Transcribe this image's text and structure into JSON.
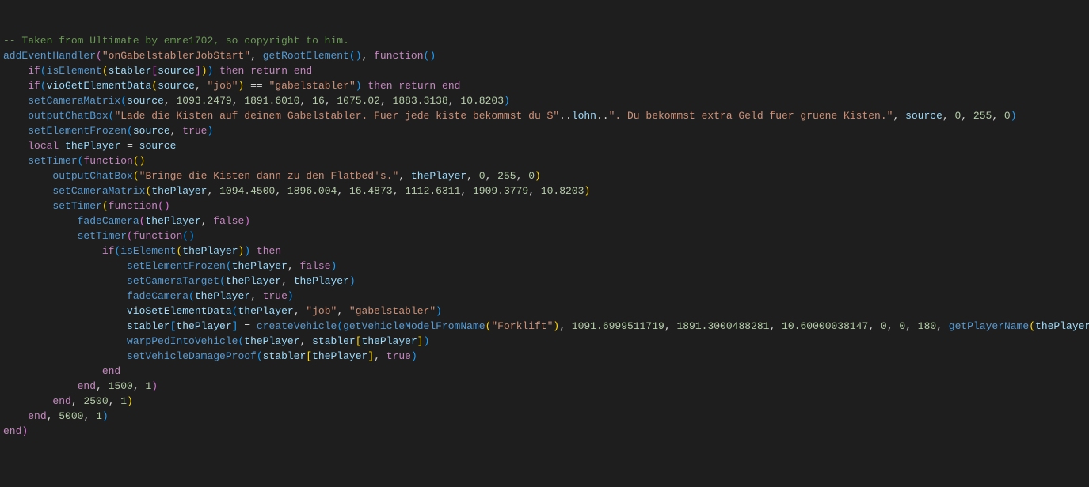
{
  "comment": "-- Taken from Ultimate by emre1702, so copyright to him.",
  "fn": {
    "addEventHandler": "addEventHandler",
    "getRootElement": "getRootElement",
    "isElement": "isElement",
    "setCameraMatrix": "setCameraMatrix",
    "outputChatBox": "outputChatBox",
    "setElementFrozen": "setElementFrozen",
    "setTimer": "setTimer",
    "fadeCamera": "fadeCamera",
    "setCameraTarget": "setCameraTarget",
    "createVehicle": "createVehicle",
    "getVehicleModelFromName": "getVehicleModelFromName",
    "warpPedIntoVehicle": "warpPedIntoVehicle",
    "setVehicleDamageProof": "setVehicleDamageProof",
    "getPlayerName": "getPlayerName",
    "vioGetElementData": "vioGetElementData",
    "vioSetElementData": "vioSetElementData"
  },
  "str": {
    "event": "\"onGabelstablerJobStart\"",
    "job": "\"job\"",
    "gabelstabler": "\"gabelstabler\"",
    "chat1a": "\"Lade die Kisten auf deinem Gabelstabler. Fuer jede kiste bekommst du $\"",
    "chat1b": "\". Du bekommst extra Geld fuer gruene Kisten.\"",
    "chat2": "\"Bringe die Kisten dann zu den Flatbed's.\"",
    "forklift": "\"Forklift\""
  },
  "num": {
    "m1": [
      "1093.2479",
      "1891.6010",
      "16",
      "1075.02",
      "1883.3138",
      "10.8203"
    ],
    "m2": [
      "1094.4500",
      "1896.004",
      "16.4873",
      "1112.6311",
      "1909.3779",
      "10.8203"
    ],
    "cv": [
      "1091.6999511719",
      "1891.3000488281",
      "10.60000038147",
      "0",
      "0",
      "180"
    ],
    "t1": [
      "5000",
      "1"
    ],
    "t2": [
      "2500",
      "1"
    ],
    "t3": [
      "1500",
      "1"
    ],
    "c1": [
      "0",
      "255",
      "0"
    ],
    "c2": [
      "0",
      "255",
      "0"
    ]
  },
  "kw": {
    "function": "function",
    "if": "if",
    "then": "then",
    "return": "return",
    "end": "end",
    "local": "local",
    "true": "true",
    "false": "false"
  },
  "id": {
    "source": "source",
    "stabler": "stabler",
    "thePlayer": "thePlayer",
    "lohn": "lohn"
  }
}
